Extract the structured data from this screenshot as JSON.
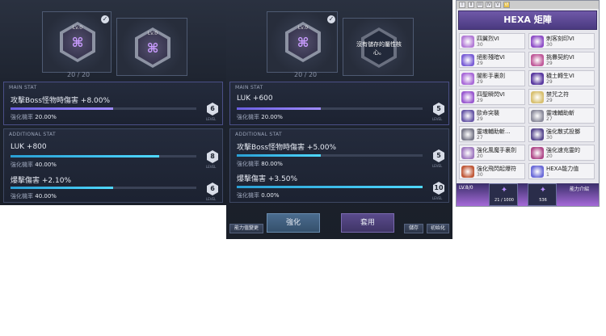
{
  "panel1": {
    "slot_lv": "Lv.0",
    "progress": "20 / 20",
    "main_label": "MAIN STAT",
    "main_stat": "攻擊Boss怪物時傷害 +8.00%",
    "main_rate": "強化機率",
    "main_rate_val": "20.00%",
    "main_level": "6",
    "main_fill": 0.55,
    "add_label": "ADDITIONAL STAT",
    "add1_stat": "LUK +800",
    "add1_rate": "強化機率",
    "add1_rate_val": "40.00%",
    "add1_level": "8",
    "add1_fill": 0.8,
    "add2_stat": "爆擊傷害 +2.10%",
    "add2_rate": "強化機率",
    "add2_rate_val": "40.00%",
    "add2_level": "6",
    "add2_fill": 0.55,
    "level_cap": "LEVEL"
  },
  "panel2": {
    "slot_lv": "Lv.0",
    "progress": "20 / 20",
    "empty_slot_text": "沒有儲存的屬性核心。",
    "main_label": "MAIN STAT",
    "main_stat": "LUK +600",
    "main_rate": "強化機率",
    "main_rate_val": "20.00%",
    "main_level": "5",
    "main_fill": 0.45,
    "add_label": "ADDITIONAL STAT",
    "add1_stat": "攻擊Boss怪物時傷害 +5.00%",
    "add1_rate": "強化機率",
    "add1_rate_val": "80.00%",
    "add1_level": "5",
    "add1_fill": 0.45,
    "add2_stat": "爆擊傷害 +3.50%",
    "add2_rate": "強化機率",
    "add2_rate_val": "0.00%",
    "add2_level": "10",
    "add2_fill": 1.0,
    "level_cap": "LEVEL",
    "buttons": {
      "enhance": "強化",
      "apply": "套用",
      "change_ability": "能力值變更",
      "save": "儲存",
      "reset": "初始化"
    }
  },
  "hexa": {
    "tabs": [
      "I",
      "II",
      "III",
      "IV",
      "V",
      "VI"
    ],
    "title": "HEXA 矩陣",
    "cells": [
      {
        "name": "四翼烈VI",
        "level": "30",
        "color": "#b27ad6"
      },
      {
        "name": "刺客刻印VI",
        "level": "30",
        "color": "#8f4fc7"
      },
      {
        "name": "絕影殘暗VI",
        "level": "29",
        "color": "#7a5ed6"
      },
      {
        "name": "挑釁契約VI",
        "level": "29",
        "color": "#c05a9a"
      },
      {
        "name": "闇影手裏劍",
        "level": "29",
        "color": "#a96ad8"
      },
      {
        "name": "穢土轉生VI",
        "level": "29",
        "color": "#5a3aa0"
      },
      {
        "name": "四聖瞬閃VI",
        "level": "29",
        "color": "#9a5ad0"
      },
      {
        "name": "禁咒之符",
        "level": "29",
        "color": "#d8c070"
      },
      {
        "name": "歐命突襲",
        "level": "29",
        "color": "#6a5aa8"
      },
      {
        "name": "靈魂輔助斬",
        "level": "27",
        "color": "#8c8c9c"
      },
      {
        "name": "靈魂輔助斬...",
        "level": "27",
        "color": "#7a7a8a"
      },
      {
        "name": "強化散式投擲",
        "level": "30",
        "color": "#5a4a90"
      },
      {
        "name": "強化風魔手裏劍",
        "level": "20",
        "color": "#a07ac0"
      },
      {
        "name": "強化速充靈的",
        "level": "20",
        "color": "#b04a8a"
      },
      {
        "name": "強化飛閃起爆符",
        "level": "30",
        "color": "#c05a3a"
      },
      {
        "name": "HEXA能力值",
        "level": "1",
        "color": "#6a6ad8"
      }
    ],
    "fragment_count": "21 / 1000",
    "fragment_count2": "536",
    "bottom_left": "LV.8/0",
    "bottom_right": "能力介紹"
  }
}
